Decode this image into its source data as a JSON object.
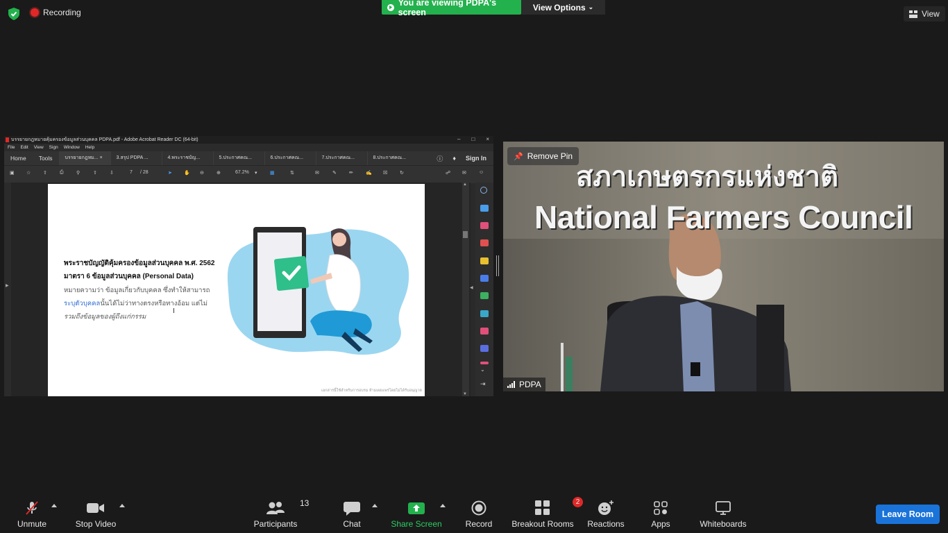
{
  "topbar": {
    "recording_label": "Recording",
    "viewing_label": "You are viewing PDPA's screen",
    "view_options_label": "View Options",
    "view_label": "View"
  },
  "acrobat": {
    "title": "บรรยายกฎหมายคุ้มครองข้อมูลส่วนบุคคล PDPA.pdf - Adobe Acrobat Reader DC (64-bit)",
    "menu": [
      "File",
      "Edit",
      "View",
      "Sign",
      "Window",
      "Help"
    ],
    "nav_home": "Home",
    "nav_tools": "Tools",
    "tabs": [
      "บรรยายกฎหม...",
      "3.สรุป PDPA ...",
      "4.พระราชบัญ...",
      "5.ประกาศคณ...",
      "6.ประกาศคณ...",
      "7.ประกาศคณ...",
      "8.ประกาศคณ..."
    ],
    "sign_in": "Sign In",
    "page_current": "7",
    "page_total": "/ 28",
    "zoom": "67.2%",
    "slide": {
      "line1": "พระราชบัญญัติคุ้มครองข้อมูลส่วนบุคคล พ.ศ. 2562",
      "line2": "มาตรา 6 ข้อมูลส่วนบุคคล (Personal Data)",
      "line3": "หมายความว่า ข้อมูลเกี่ยวกับบุคคล ซึ่งทำให้สามารถ",
      "line4_highlight": "ระบุตัวบุคคล",
      "line4_rest": "นั้นได้ไม่ว่าทางตรงหรือทางอ้อม แต่ไม่",
      "line5": "รวมถึงข้อมูลของผู้ถึงแก่กรรม",
      "footer": "เอกสารนี้ใช้สำหรับการอบรม ห้ามเผยแพร่โดยไม่ได้รับอนุญาต"
    }
  },
  "video": {
    "remove_pin": "Remove Pin",
    "participant_name": "PDPA",
    "sign_thai": "สภาเกษตรกรแห่งชาติ",
    "sign_english": "National Farmers Council"
  },
  "toolbar": {
    "unmute": "Unmute",
    "stop_video": "Stop Video",
    "participants": "Participants",
    "participants_count": "13",
    "chat": "Chat",
    "share_screen": "Share Screen",
    "record": "Record",
    "breakout_rooms": "Breakout Rooms",
    "breakout_badge": "2",
    "reactions": "Reactions",
    "apps": "Apps",
    "whiteboards": "Whiteboards",
    "leave_room": "Leave Room"
  },
  "colors": {
    "viewing_banner": "#23b14d",
    "leave_button": "#1a73d9",
    "share_icon": "#23b14d",
    "badge": "#e02828",
    "highlight_text": "#2f6fd2"
  }
}
